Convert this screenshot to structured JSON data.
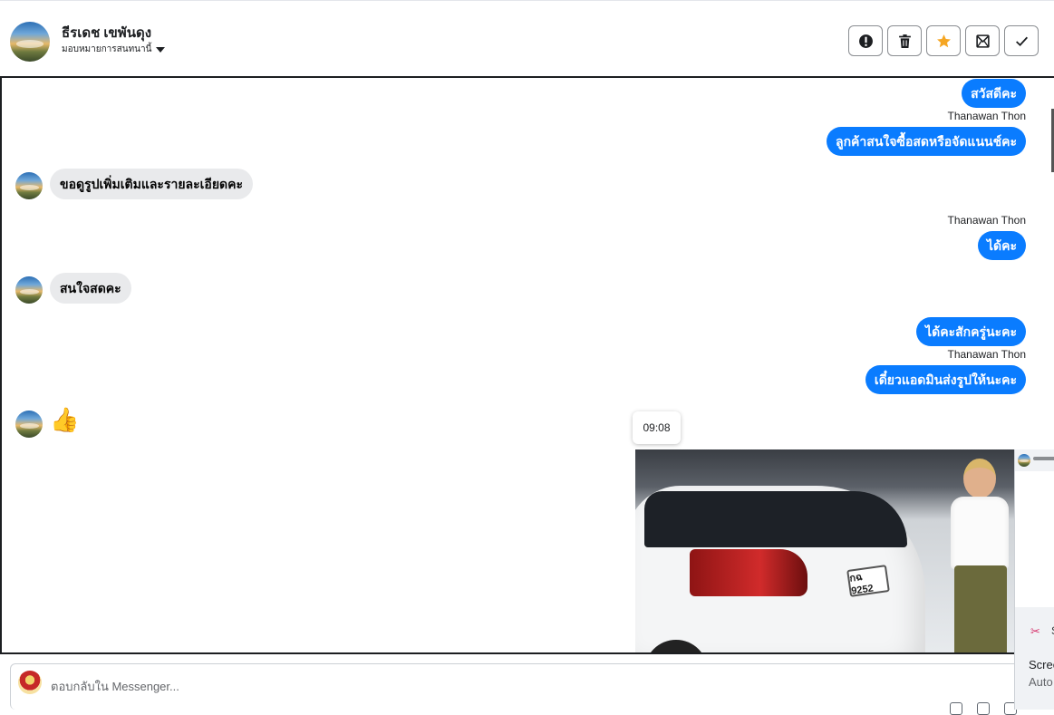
{
  "contact": {
    "name": "ธีรเดช เขพันดุง",
    "assign_label": "มอบหมายการสนทนานี้"
  },
  "actions": [
    {
      "name": "spam-button",
      "icon": "alert-icon"
    },
    {
      "name": "delete-button",
      "icon": "trash-icon"
    },
    {
      "name": "star-button",
      "icon": "star-icon",
      "color": "#f5a623"
    },
    {
      "name": "mark-unread-button",
      "icon": "envelope-icon"
    },
    {
      "name": "done-button",
      "icon": "check-icon"
    }
  ],
  "messages": {
    "m1": "สวัสดีคะ",
    "m2_sender": "Thanawan Thon",
    "m2": "ลูกค้าสนใจซื้อสดหรือจัดแนนช์คะ",
    "m3": "ขอดูรูปเพิ่มเติมและรายละเอียดคะ",
    "m4_sender": "Thanawan Thon",
    "m4": "ได้คะ",
    "m5": "สนใจสดคะ",
    "m6": "ได้คะสักครู่นะคะ",
    "m7_sender": "Thanawan Thon",
    "m7": "เดี๋ยวแอดมินส่งรูปให้นะคะ",
    "m8": "👍"
  },
  "tooltip_time": "09:08",
  "photo": {
    "plate": "กฉ 9252"
  },
  "side_panel": {
    "label": "S",
    "line1": "Scree",
    "line2": "Auto"
  },
  "composer": {
    "placeholder": "ตอบกลับใน Messenger..."
  },
  "colors": {
    "outgoing": "#0a7cff",
    "incoming": "#e9eaec",
    "star": "#f5a623"
  }
}
